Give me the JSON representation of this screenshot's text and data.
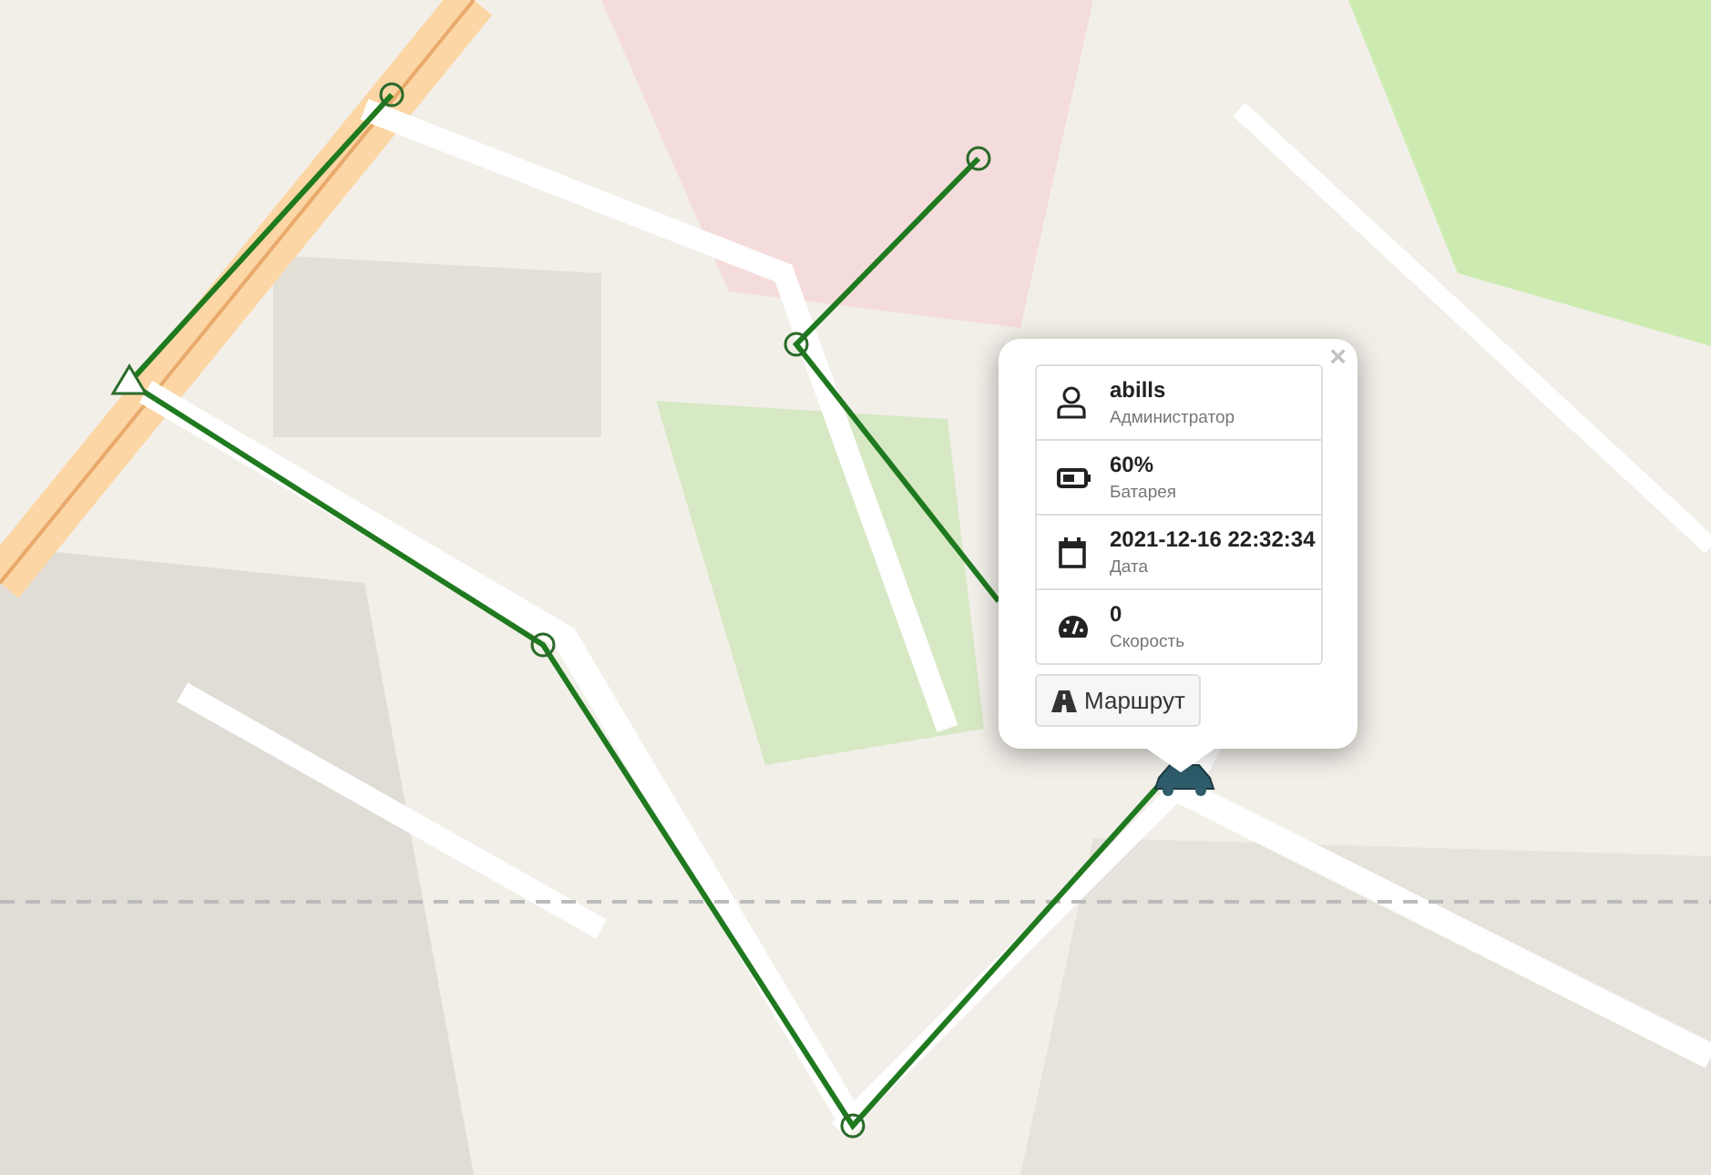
{
  "popup": {
    "close": "×",
    "rows": [
      {
        "kind": "user",
        "value": "abills",
        "label": "Администратор"
      },
      {
        "kind": "battery",
        "value": "60%",
        "label": "Батарея"
      },
      {
        "kind": "date",
        "value": "2021-12-16 22:32:34",
        "label": "Дата"
      },
      {
        "kind": "speed",
        "value": "0",
        "label": "Скорость"
      }
    ],
    "button": "Маршрут"
  }
}
